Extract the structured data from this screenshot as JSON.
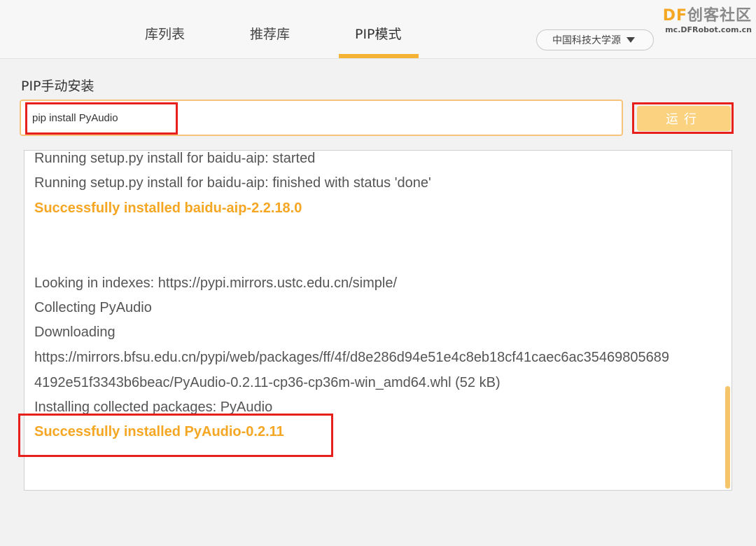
{
  "tabs": [
    {
      "label": "库列表"
    },
    {
      "label": "推荐库"
    },
    {
      "label": "PIP模式"
    }
  ],
  "mirror_select": {
    "value": "中国科技大学源"
  },
  "logo": {
    "brand_prefix": "DF",
    "brand_suffix": "创客社区",
    "site": "mc.DFRobot.com.cn"
  },
  "manual_install": {
    "title": "PIP手动安装",
    "command": "pip install PyAudio",
    "run_label": "运行"
  },
  "console": {
    "lines": [
      "    Running setup.py install for baidu-aip: started",
      "    Running setup.py install for baidu-aip: finished with status 'done'",
      "Successfully installed baidu-aip-2.2.18.0",
      "Looking in indexes: https://pypi.mirrors.ustc.edu.cn/simple/",
      "Collecting PyAudio",
      "  Downloading",
      "https://mirrors.bfsu.edu.cn/pypi/web/packages/ff/4f/d8e286d94e51e4c8eb18cf41caec6ac35469805689",
      "4192e51f3343b6beac/PyAudio-0.2.11-cp36-cp36m-win_amd64.whl (52 kB)",
      "Installing collected packages: PyAudio",
      "Successfully installed PyAudio-0.2.11"
    ]
  },
  "colors": {
    "accent": "#f5a623",
    "highlight": "#e8201c",
    "button": "#fbd27f"
  }
}
